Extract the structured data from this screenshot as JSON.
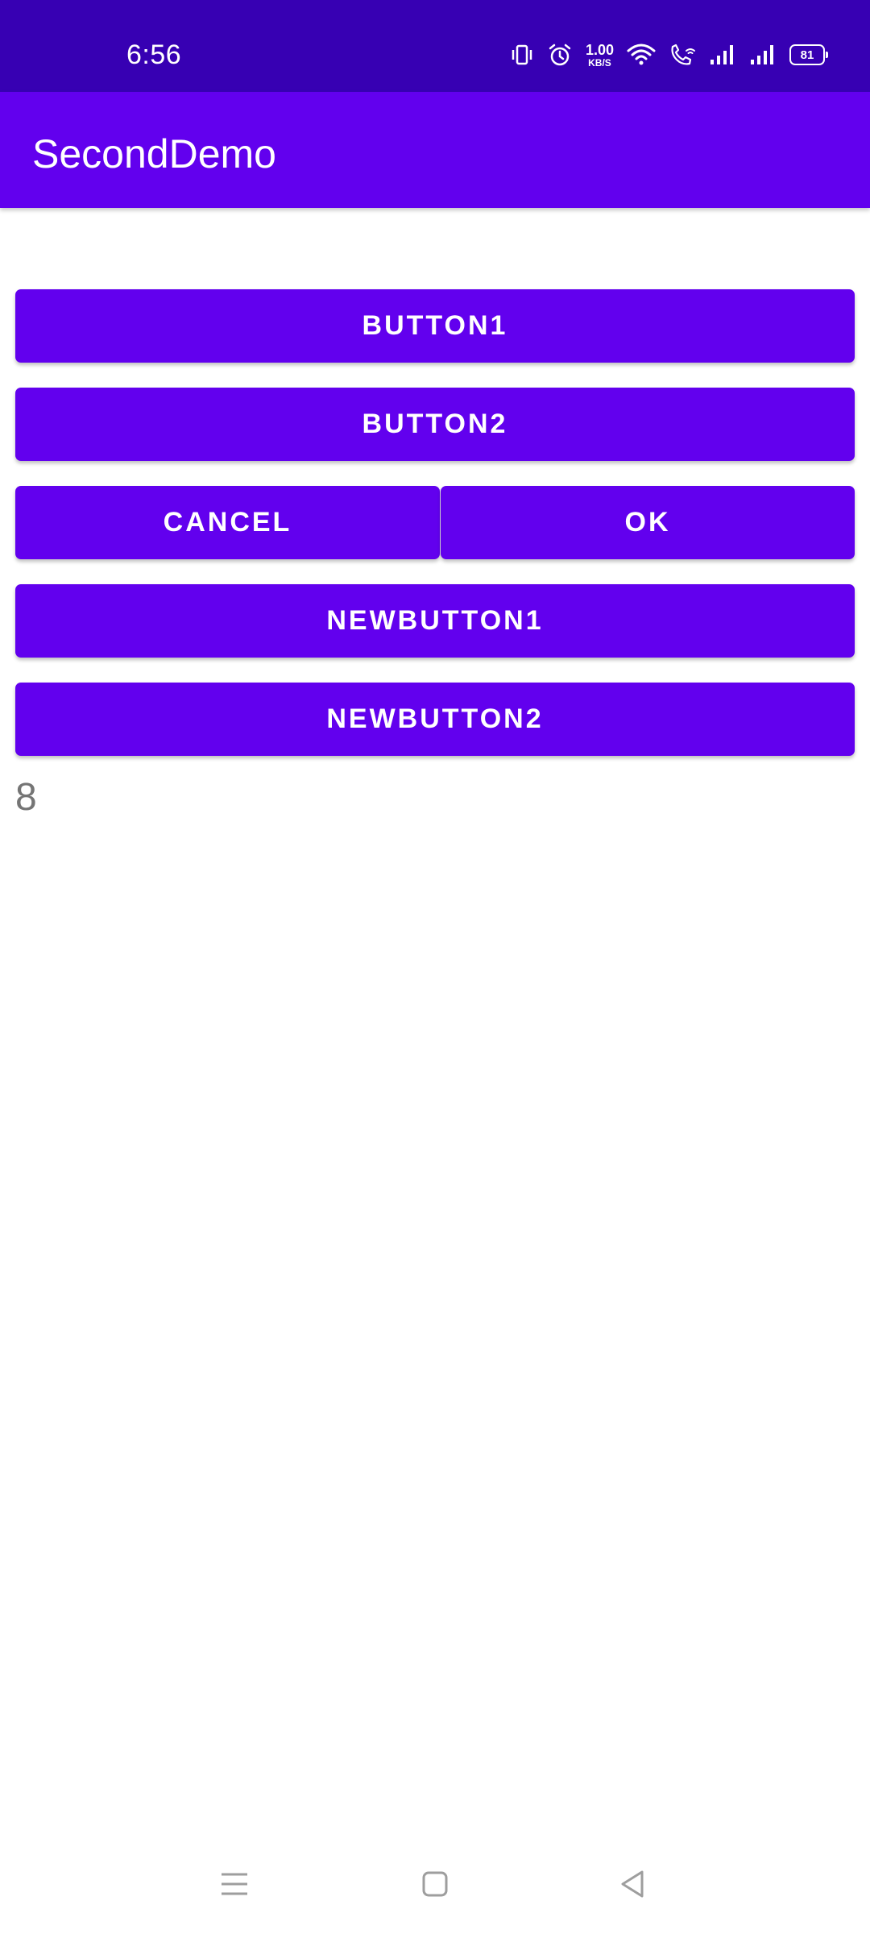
{
  "status_bar": {
    "time": "6:56",
    "net_speed_value": "1.00",
    "net_speed_unit": "KB/S",
    "battery_level": "81",
    "icons": [
      "vibrate-icon",
      "alarm-icon",
      "net-speed-indicator",
      "wifi-icon",
      "wifi-calling-icon",
      "signal-icon",
      "signal-icon",
      "battery-icon"
    ]
  },
  "app_bar": {
    "title": "SecondDemo"
  },
  "buttons": {
    "button1": "BUTTON1",
    "button2": "BUTTON2",
    "cancel": "CANCEL",
    "ok": "OK",
    "newbutton1": "NEWBUTTON1",
    "newbutton2": "NEWBUTTON2"
  },
  "counter": {
    "value": "8"
  },
  "nav_bar": {
    "icons": [
      "menu-icon",
      "home-icon",
      "back-icon"
    ]
  },
  "colors": {
    "status_bar": "#3700b3",
    "primary": "#6200ee",
    "on_primary": "#ffffff",
    "counter_text": "#757575",
    "nav_icon": "#9e9e9e"
  }
}
